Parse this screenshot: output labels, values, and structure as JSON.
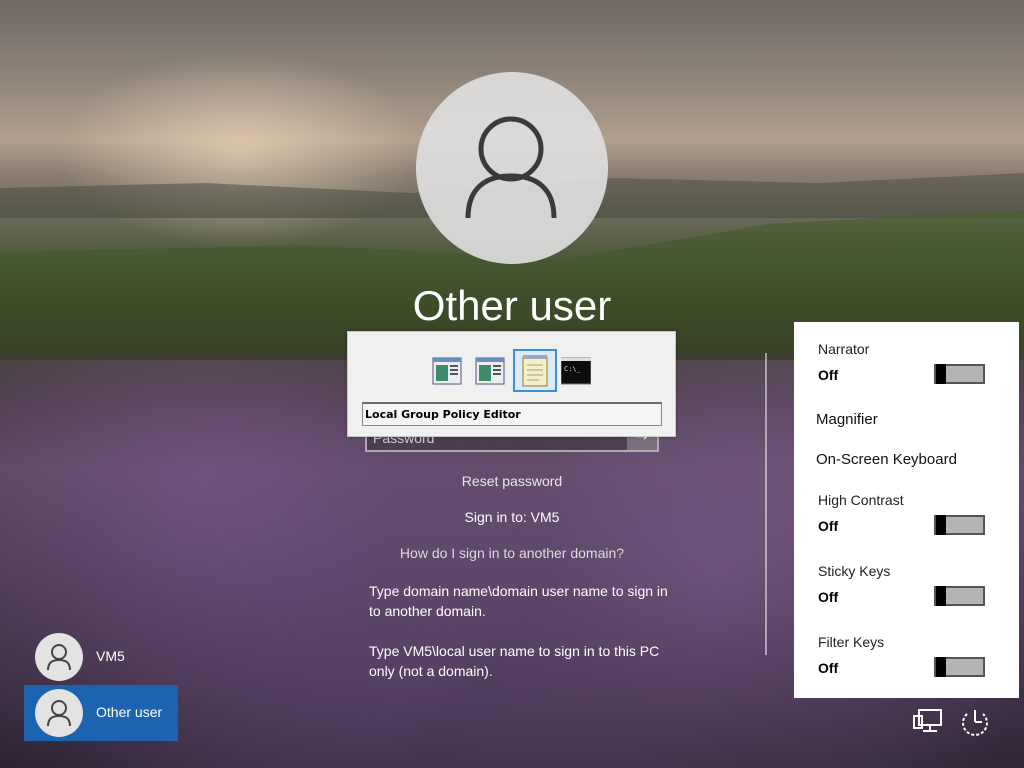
{
  "login": {
    "username_title": "Other user",
    "password_placeholder": "Password",
    "submit_arrow": "→",
    "reset_password": "Reset password",
    "sign_in_to": "Sign in to: VM5",
    "other_domain_link": "How do I sign in to another domain?",
    "help_domain": "Type domain name\\domain user name to sign in to another domain.",
    "help_local": "Type VM5\\local user name to sign in to this PC only (not a domain)."
  },
  "task_switcher": {
    "selected_label": "Local Group Policy Editor",
    "icons": [
      "window-app-icon",
      "window-app-icon",
      "notepad-icon",
      "command-prompt-icon"
    ],
    "cmd_glyph": "C:\\_"
  },
  "accessibility": {
    "items": [
      {
        "label": "Narrator",
        "state": "Off"
      },
      {
        "label": "Magnifier"
      },
      {
        "label": "On-Screen Keyboard"
      },
      {
        "label": "High Contrast",
        "state": "Off"
      },
      {
        "label": "Sticky Keys",
        "state": "Off"
      },
      {
        "label": "Filter Keys",
        "state": "Off"
      }
    ]
  },
  "users": [
    {
      "name": "VM5",
      "selected": false
    },
    {
      "name": "Other user",
      "selected": true
    }
  ],
  "corner_icons": [
    "network-icon",
    "power-icon"
  ],
  "colors": {
    "selected_user": "#1d64b0",
    "switcher_highlight": "#3b8fd8"
  }
}
